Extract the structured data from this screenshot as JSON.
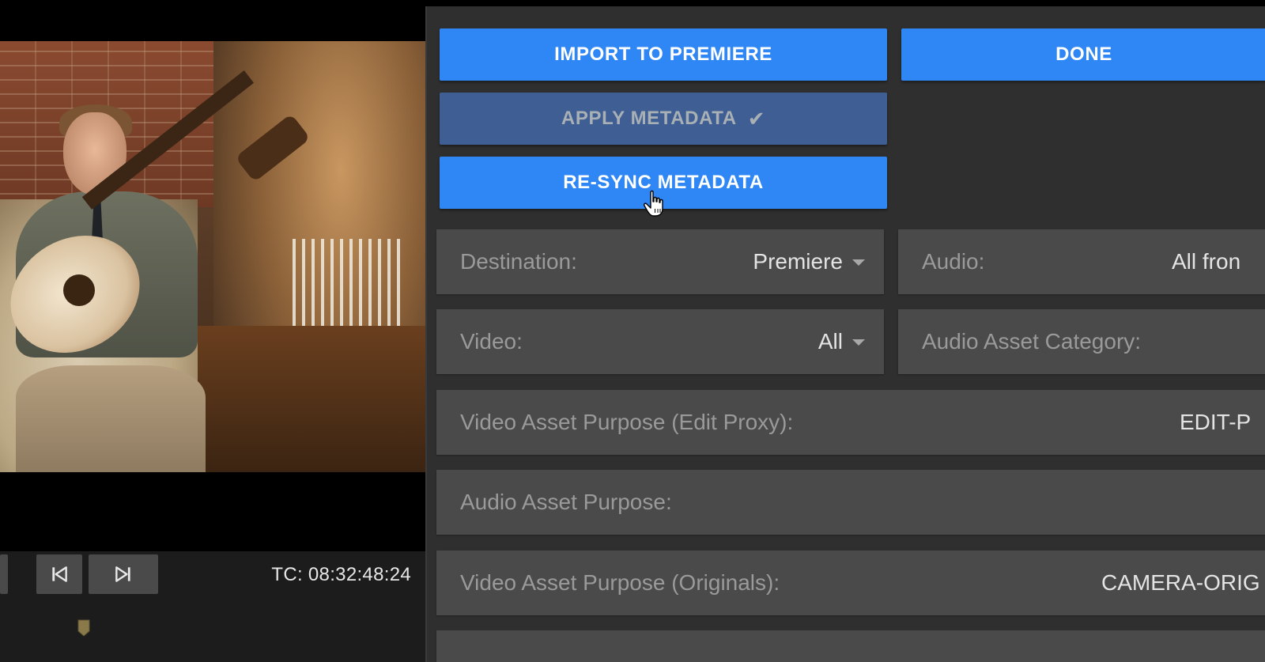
{
  "player": {
    "timecode": "TC: 08:32:48:24",
    "prev_icon": "skip-back-icon",
    "next_icon": "skip-forward-icon"
  },
  "actions": {
    "import_label": "IMPORT TO PREMIERE",
    "done_label": "DONE",
    "apply_label": "APPLY METADATA",
    "apply_check": "✔",
    "resync_label": "RE-SYNC METADATA"
  },
  "fields": {
    "destination_label": "Destination:",
    "destination_value": "Premiere",
    "audio_label": "Audio:",
    "audio_value": "All fron",
    "video_label": "Video:",
    "video_value": "All",
    "audio_asset_category_label": "Audio Asset Category:",
    "video_asset_purpose_edit_label": "Video Asset Purpose (Edit Proxy):",
    "video_asset_purpose_edit_value": "EDIT-P",
    "audio_asset_purpose_label": "Audio Asset Purpose:",
    "video_asset_purpose_originals_label": "Video Asset Purpose (Originals):",
    "video_asset_purpose_originals_value": "CAMERA-ORIG"
  },
  "colors": {
    "primary_button": "#2f86f5",
    "disabled_button": "#3f5f94",
    "panel_bg": "#2f2f2f",
    "field_bg": "#4a4a4a"
  }
}
